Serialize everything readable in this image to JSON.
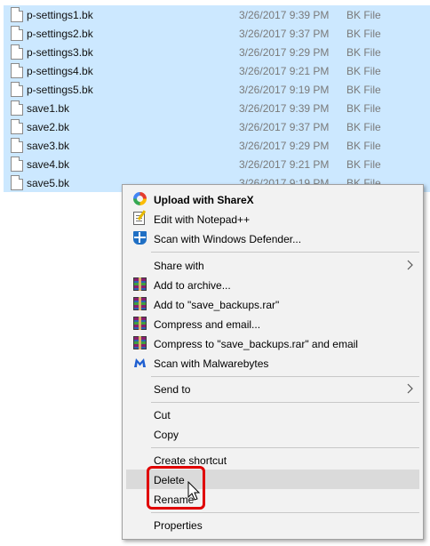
{
  "files": [
    {
      "name": "p-settings1.bk",
      "date": "3/26/2017 9:39 PM",
      "type": "BK File"
    },
    {
      "name": "p-settings2.bk",
      "date": "3/26/2017 9:37 PM",
      "type": "BK File"
    },
    {
      "name": "p-settings3.bk",
      "date": "3/26/2017 9:29 PM",
      "type": "BK File"
    },
    {
      "name": "p-settings4.bk",
      "date": "3/26/2017 9:21 PM",
      "type": "BK File"
    },
    {
      "name": "p-settings5.bk",
      "date": "3/26/2017 9:19 PM",
      "type": "BK File"
    },
    {
      "name": "save1.bk",
      "date": "3/26/2017 9:39 PM",
      "type": "BK File"
    },
    {
      "name": "save2.bk",
      "date": "3/26/2017 9:37 PM",
      "type": "BK File"
    },
    {
      "name": "save3.bk",
      "date": "3/26/2017 9:29 PM",
      "type": "BK File"
    },
    {
      "name": "save4.bk",
      "date": "3/26/2017 9:21 PM",
      "type": "BK File"
    },
    {
      "name": "save5.bk",
      "date": "3/26/2017 9:19 PM",
      "type": "BK File"
    }
  ],
  "menu": {
    "upload_sharex": "Upload with ShareX",
    "edit_notepad": "Edit with Notepad++",
    "scan_defender": "Scan with Windows Defender...",
    "share_with": "Share with",
    "add_archive": "Add to archive...",
    "add_rar": "Add to \"save_backups.rar\"",
    "compress_email": "Compress and email...",
    "compress_rar_email": "Compress to \"save_backups.rar\" and email",
    "scan_malwarebytes": "Scan with Malwarebytes",
    "send_to": "Send to",
    "cut": "Cut",
    "copy": "Copy",
    "create_shortcut": "Create shortcut",
    "delete": "Delete",
    "rename": "Rename",
    "properties": "Properties"
  },
  "colors": {
    "selection": "#cce8ff",
    "menu_bg": "#f2f2f2",
    "hover": "#dadada",
    "highlight": "#e00000"
  }
}
